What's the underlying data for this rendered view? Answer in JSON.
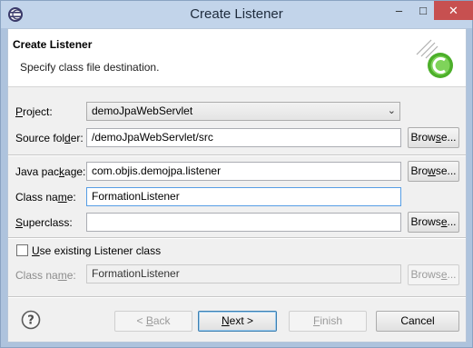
{
  "window": {
    "title": "Create Listener",
    "controls": {
      "minimize": "–",
      "maximize": "□",
      "close": "✕"
    }
  },
  "header": {
    "title": "Create Listener",
    "description": "Specify class file destination."
  },
  "form": {
    "project": {
      "label_pre": "",
      "label_mn": "P",
      "label_post": "roject:",
      "value": "demoJpaWebServlet"
    },
    "source_folder": {
      "label_pre": "Source fol",
      "label_mn": "d",
      "label_post": "er:",
      "value": "/demoJpaWebServlet/src",
      "browse_pre": "Brow",
      "browse_mn": "s",
      "browse_post": "e..."
    },
    "java_package": {
      "label_pre": "Java pac",
      "label_mn": "k",
      "label_post": "age:",
      "value": "com.objis.demojpa.listener",
      "browse_pre": "Bro",
      "browse_mn": "w",
      "browse_post": "se..."
    },
    "class_name": {
      "label_pre": "Class na",
      "label_mn": "m",
      "label_post": "e:",
      "value": "FormationListener"
    },
    "superclass": {
      "label_pre": "",
      "label_mn": "S",
      "label_post": "uperclass:",
      "value": "",
      "browse_pre": "Brows",
      "browse_mn": "e",
      "browse_post": "..."
    },
    "use_existing": {
      "label_pre": "",
      "label_mn": "U",
      "label_post": "se existing Listener class",
      "checked": false
    },
    "existing_class_name": {
      "label_pre": "Class na",
      "label_mn": "m",
      "label_post": "e:",
      "value": "FormationListener",
      "browse_pre": "Brows",
      "browse_mn": "e",
      "browse_post": "..."
    }
  },
  "footer": {
    "back_pre": "< ",
    "back_mn": "B",
    "back_post": "ack",
    "next_pre": "",
    "next_mn": "N",
    "next_post": "ext >",
    "finish_pre": "",
    "finish_mn": "F",
    "finish_post": "inish",
    "cancel": "Cancel"
  },
  "icons": {
    "title": "eclipse-icon",
    "banner": "wizard-banner-icon",
    "help": "help-icon"
  },
  "colors": {
    "titlebar": "#c2d4ea",
    "close_button": "#c75050",
    "focus_border": "#569de5",
    "banner_green": "#4caf2a"
  }
}
